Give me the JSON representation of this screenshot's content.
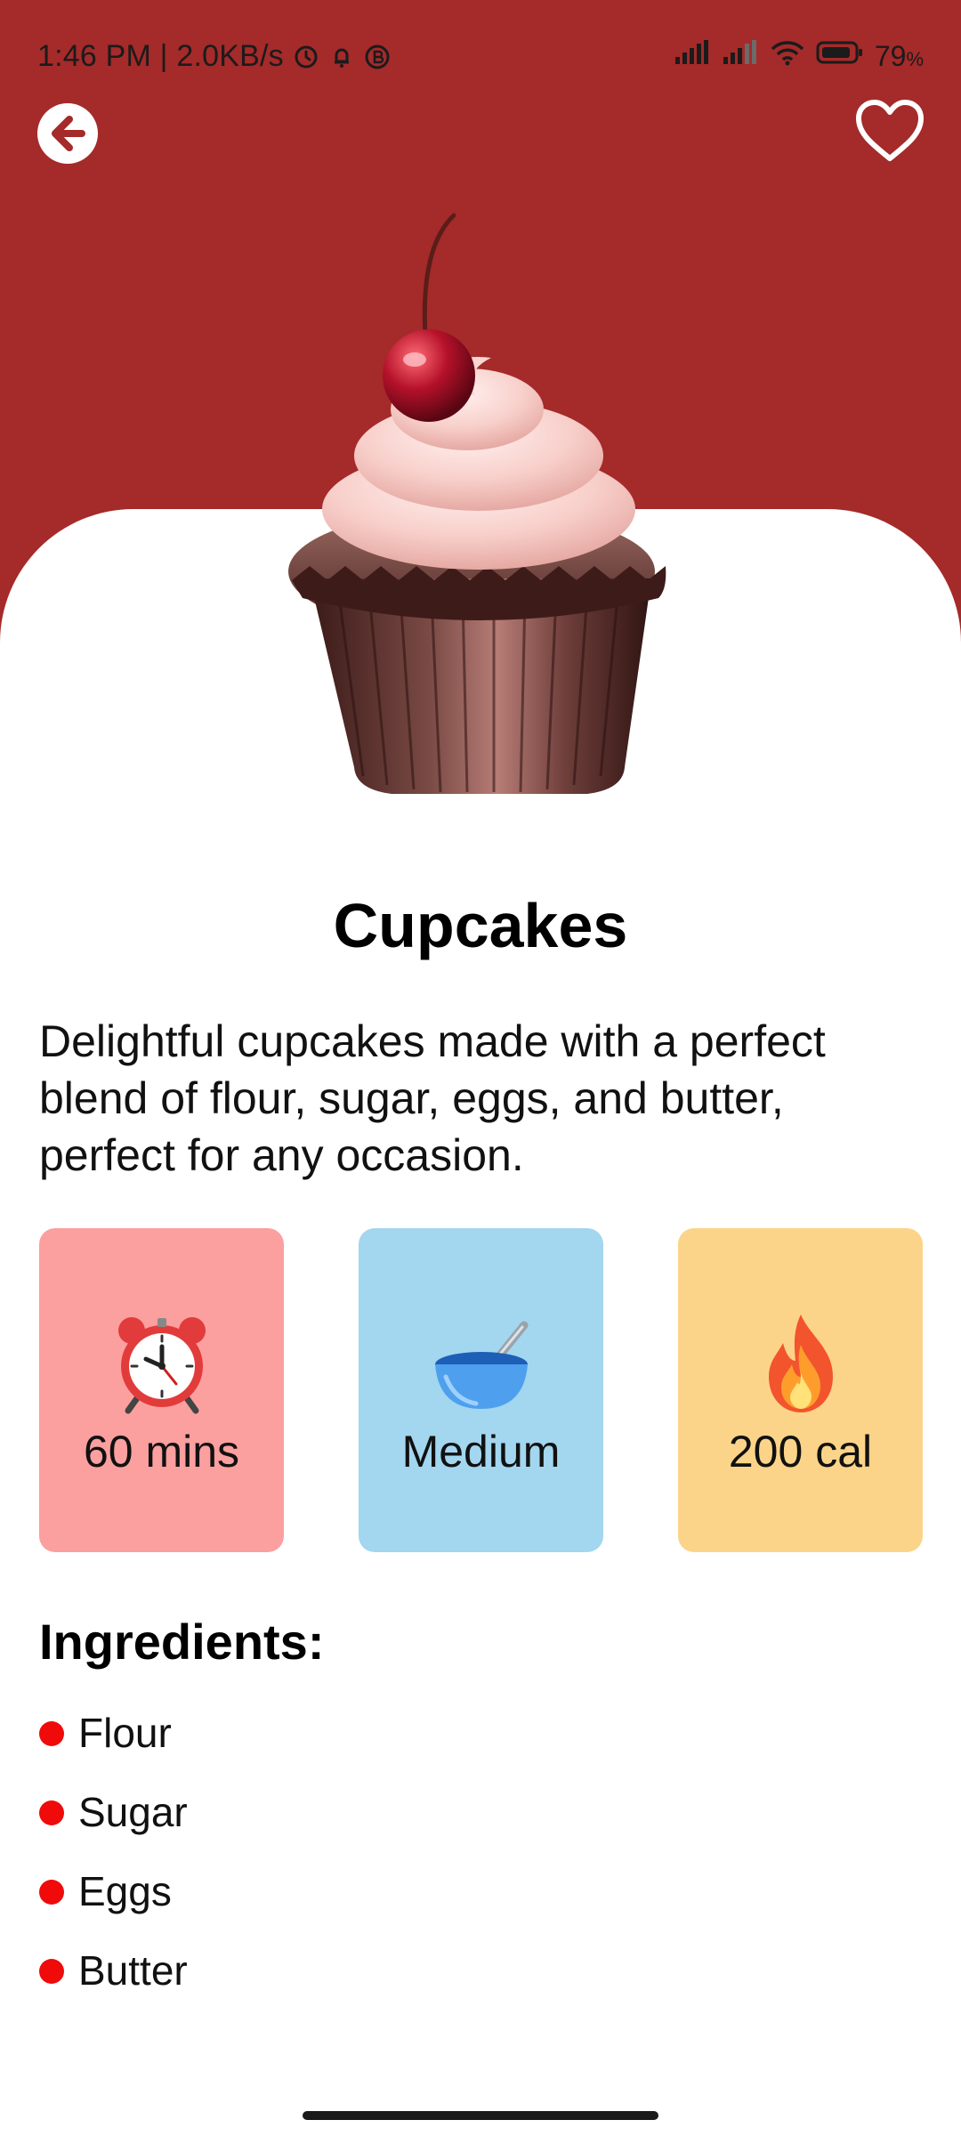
{
  "status_bar": {
    "time_speed": "1:46 PM | 2.0KB/s",
    "battery": "79",
    "battery_unit": "%",
    "icons": [
      "alarm-icon",
      "notification-bell-icon",
      "bluetooth-badge-icon",
      "cellular-signal-icon",
      "cellular-signal-icon",
      "wifi-icon",
      "battery-icon"
    ]
  },
  "header": {
    "back_icon": "arrow-left-circle-icon",
    "favorite_icon": "heart-outline-icon"
  },
  "colors": {
    "hero_background": "#a52a2a",
    "time_card": "#fc9f9f",
    "difficulty_card": "#a3d6ef",
    "calories_card": "#fcd489",
    "bullet": "#f00a0a"
  },
  "recipe": {
    "title": "Cupcakes",
    "description": "Delightful cupcakes made with a perfect blend of flour, sugar, eggs, and butter, perfect for any occasion.",
    "image_icon": "cupcake-icon",
    "stats": [
      {
        "icon": "alarm-clock-icon",
        "label": "60 mins"
      },
      {
        "icon": "mixing-bowl-icon",
        "label": "Medium"
      },
      {
        "icon": "fire-icon",
        "label": "200 cal"
      }
    ],
    "ingredients_title": "Ingredients:",
    "ingredients": [
      "Flour",
      "Sugar",
      "Eggs",
      "Butter"
    ]
  }
}
